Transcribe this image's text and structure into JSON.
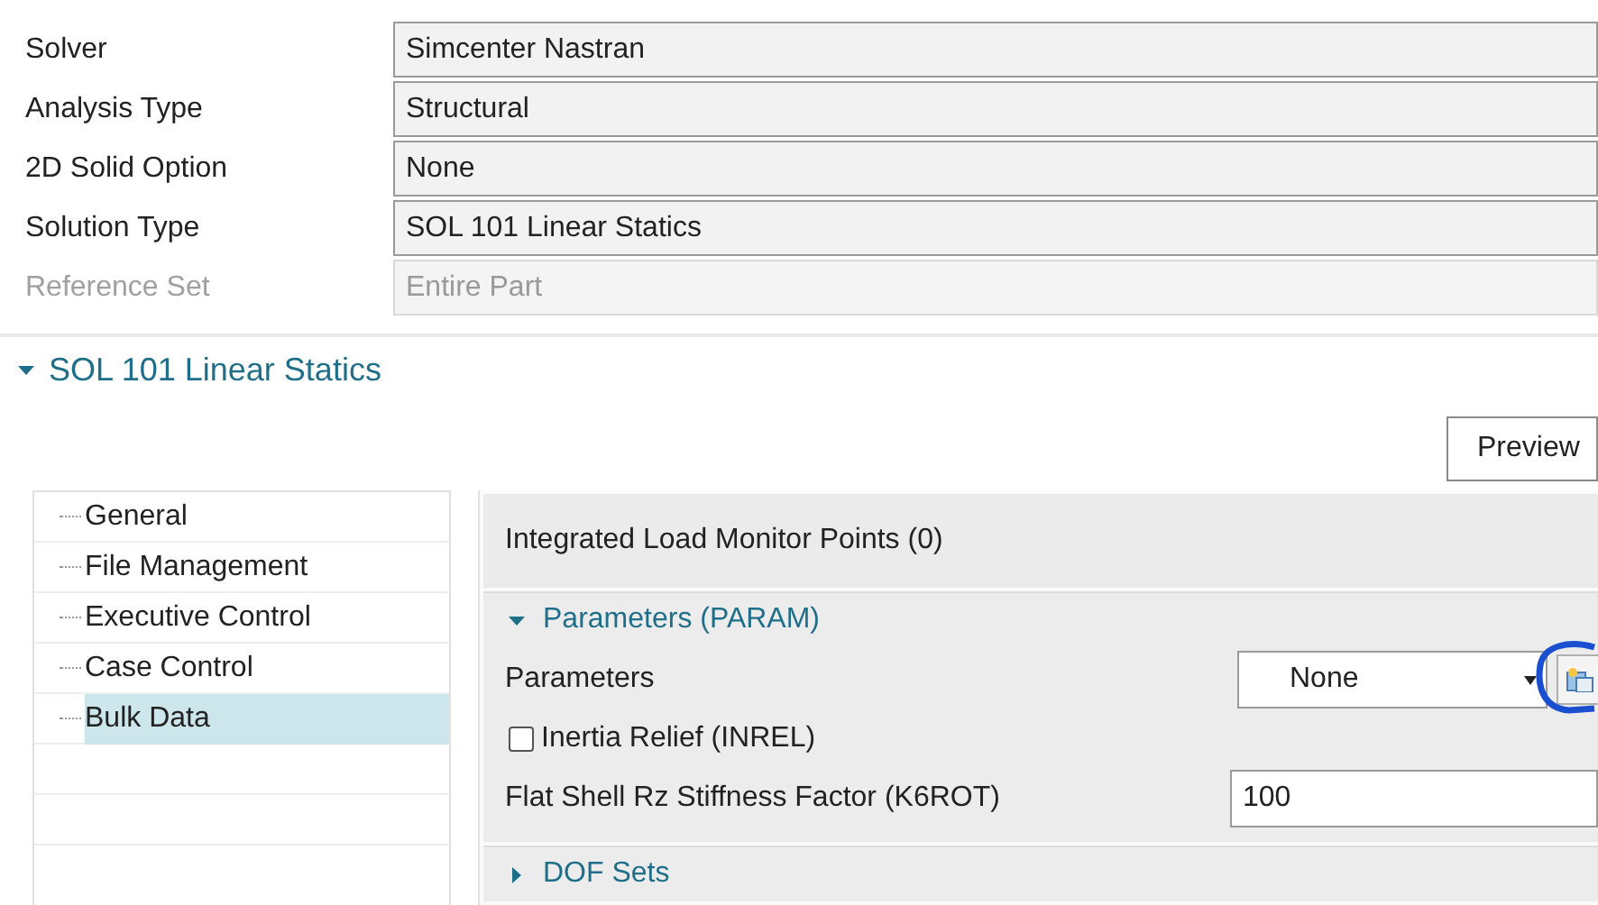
{
  "properties": [
    {
      "label": "Solver",
      "value": "Simcenter Nastran",
      "disabled": false
    },
    {
      "label": "Analysis Type",
      "value": "Structural",
      "disabled": false
    },
    {
      "label": "2D Solid Option",
      "value": "None",
      "disabled": false
    },
    {
      "label": "Solution Type",
      "value": "SOL 101 Linear Statics",
      "disabled": false
    },
    {
      "label": "Reference Set",
      "value": "Entire Part",
      "disabled": true
    }
  ],
  "solution_section": {
    "title": "SOL 101 Linear Statics",
    "expanded": true
  },
  "preview_button": "Preview",
  "tree": {
    "items": [
      {
        "label": "General",
        "selected": false
      },
      {
        "label": "File Management",
        "selected": false
      },
      {
        "label": "Executive Control",
        "selected": false
      },
      {
        "label": "Case Control",
        "selected": false
      },
      {
        "label": "Bulk Data",
        "selected": true
      }
    ]
  },
  "panel": {
    "monitor_points": "Integrated Load Monitor Points (0)",
    "groups": [
      {
        "title": "Parameters (PARAM)",
        "expanded": true,
        "rows": [
          {
            "kind": "dropdown",
            "label": "Parameters",
            "value": "None"
          },
          {
            "kind": "checkbox",
            "label": "Inertia Relief (INREL)",
            "checked": false
          },
          {
            "kind": "number",
            "label": "Flat Shell Rz Stiffness Factor (K6ROT)",
            "value": "100"
          }
        ]
      },
      {
        "title": "DOF Sets",
        "expanded": false
      }
    ]
  }
}
